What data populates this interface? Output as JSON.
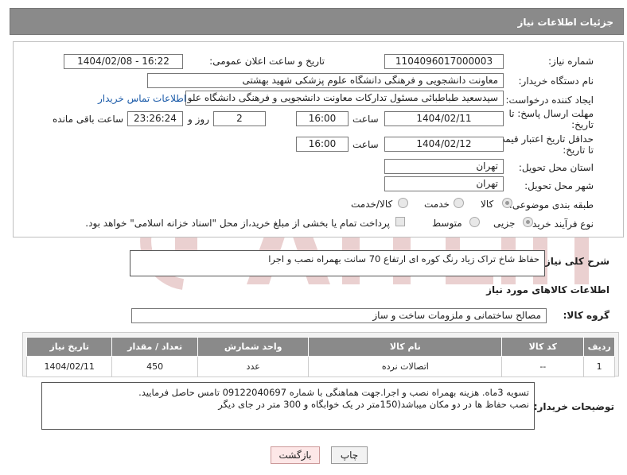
{
  "header": {
    "title": "جزئیات اطلاعات نیاز"
  },
  "fields": {
    "need_number_label": "شماره نیاز:",
    "need_number": "1104096017000003",
    "announce_label": "تاریخ و ساعت اعلان عمومی:",
    "announce_value": "1404/02/08 - 16:22",
    "buyer_org_label": "نام دستگاه خریدار:",
    "buyer_org": "معاونت دانشجویی و فرهنگی دانشگاه علوم پزشکی شهید بهشتی",
    "creator_label": "ایجاد کننده درخواست:",
    "creator": "سپدسعید طباطبائی مسئول تدارکات معاونت دانشجویی و فرهنگی دانشگاه علو",
    "buyer_contact_link": "اطلاعات تماس خریدار",
    "reply_deadline_label_1": "مهلت ارسال پاسخ: تا",
    "reply_deadline_label_2": "تاریخ:",
    "reply_date": "1404/02/11",
    "time_label": "ساعت",
    "reply_time": "16:00",
    "days_value": "2",
    "days_label": "روز و",
    "remaining_time": "23:26:24",
    "remaining_label": "ساعت باقی مانده",
    "price_validity_label_1": "حداقل تاریخ اعتبار قیمت:",
    "price_validity_label_2": "تا تاریخ:",
    "price_date": "1404/02/12",
    "price_time": "16:00",
    "province_label": "استان محل تحویل:",
    "province": "تهران",
    "city_label": "شهر محل تحویل:",
    "city": "تهران",
    "category_label": "طبقه بندی موضوعی:",
    "category_options": [
      "کالا",
      "خدمت",
      "کالا/خدمت"
    ],
    "purchase_type_label": "نوع فرآیند خرید :",
    "purchase_options": [
      "جزیی",
      "متوسط"
    ],
    "payment_note": "پرداخت تمام یا بخشی از مبلغ خرید،از محل \"اسناد خزانه اسلامی\" خواهد بود."
  },
  "description": {
    "label": "شرح کلی نیاز:",
    "text": "حفاظ شاخ تراک زیاد رنگ کوره ای ارتفاع 70 سانت بهمراه نصب و اجرا"
  },
  "goods": {
    "section_title": "اطلاعات کالاهای مورد نیاز",
    "group_label": "گروه کالا:",
    "group_value": "مصالح ساختمانی و ملزومات ساخت و ساز",
    "columns": [
      "ردیف",
      "کد کالا",
      "نام کالا",
      "واحد شمارش",
      "تعداد / مقدار",
      "تاریخ نیاز"
    ],
    "rows": [
      [
        "1",
        "--",
        "اتصالات نرده",
        "عدد",
        "450",
        "1404/02/11"
      ]
    ]
  },
  "buyer_notes": {
    "label": "توضیحات خریدار:",
    "line1": "تسویه 3ماه. هزینه بهمراه نصب  و اجرا.جهت هماهنگی با شماره 09122040697 تامس حاصل فرمایید.",
    "line2": "نصب حفاظ ها در دو مکان میباشد(150متر در یک خوابگاه و 300 متر در جای دیگر"
  },
  "buttons": {
    "print": "چاپ",
    "back": "بازگشت"
  },
  "colors": {
    "header_bg": "#8a8a8a",
    "link": "#1a5aa8",
    "watermark": "#e8c4c4"
  }
}
